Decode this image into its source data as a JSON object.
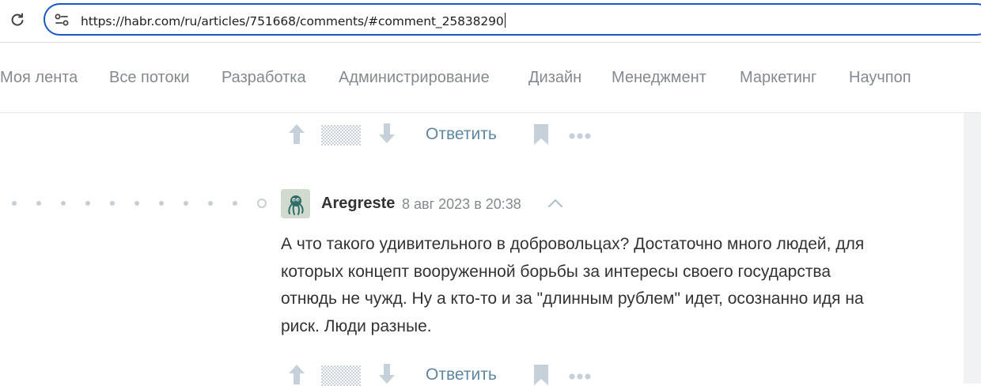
{
  "browser": {
    "url": "https://habr.com/ru/articles/751668/comments/#comment_25838290"
  },
  "nav": {
    "items": [
      {
        "label": "Моя лента"
      },
      {
        "label": "Все потоки"
      },
      {
        "label": "Разработка"
      },
      {
        "label": "Администрирование"
      },
      {
        "label": "Дизайн"
      },
      {
        "label": "Менеджмент"
      },
      {
        "label": "Маркетинг"
      },
      {
        "label": "Научпоп"
      }
    ]
  },
  "actions": {
    "reply_label": "Ответить"
  },
  "comment": {
    "author": "Aregreste",
    "date": "8 авг 2023 в 20:38",
    "lines": [
      "А что такого удивительного в добровольцах? Достаточно много людей, для",
      "которых концепт вооруженной борьбы за интересы своего государства",
      "отнюдь не чужд. Ну а кто-то и за \"длинным рублем\" идет, осознанно идя на",
      "риск. Люди разные."
    ]
  },
  "icons": {
    "reload": "reload-icon",
    "site_info": "site-info-icon",
    "vote_up": "arrow-up-icon",
    "vote_down": "arrow-down-icon",
    "bookmark": "bookmark-icon",
    "more": "more-icon",
    "collapse": "chevron-up-icon"
  },
  "colors": {
    "accent": "#5d87a1",
    "omnibox_border": "#1a57c4",
    "nav_text": "#838a8f",
    "muted_icon": "#c5d0d8"
  }
}
